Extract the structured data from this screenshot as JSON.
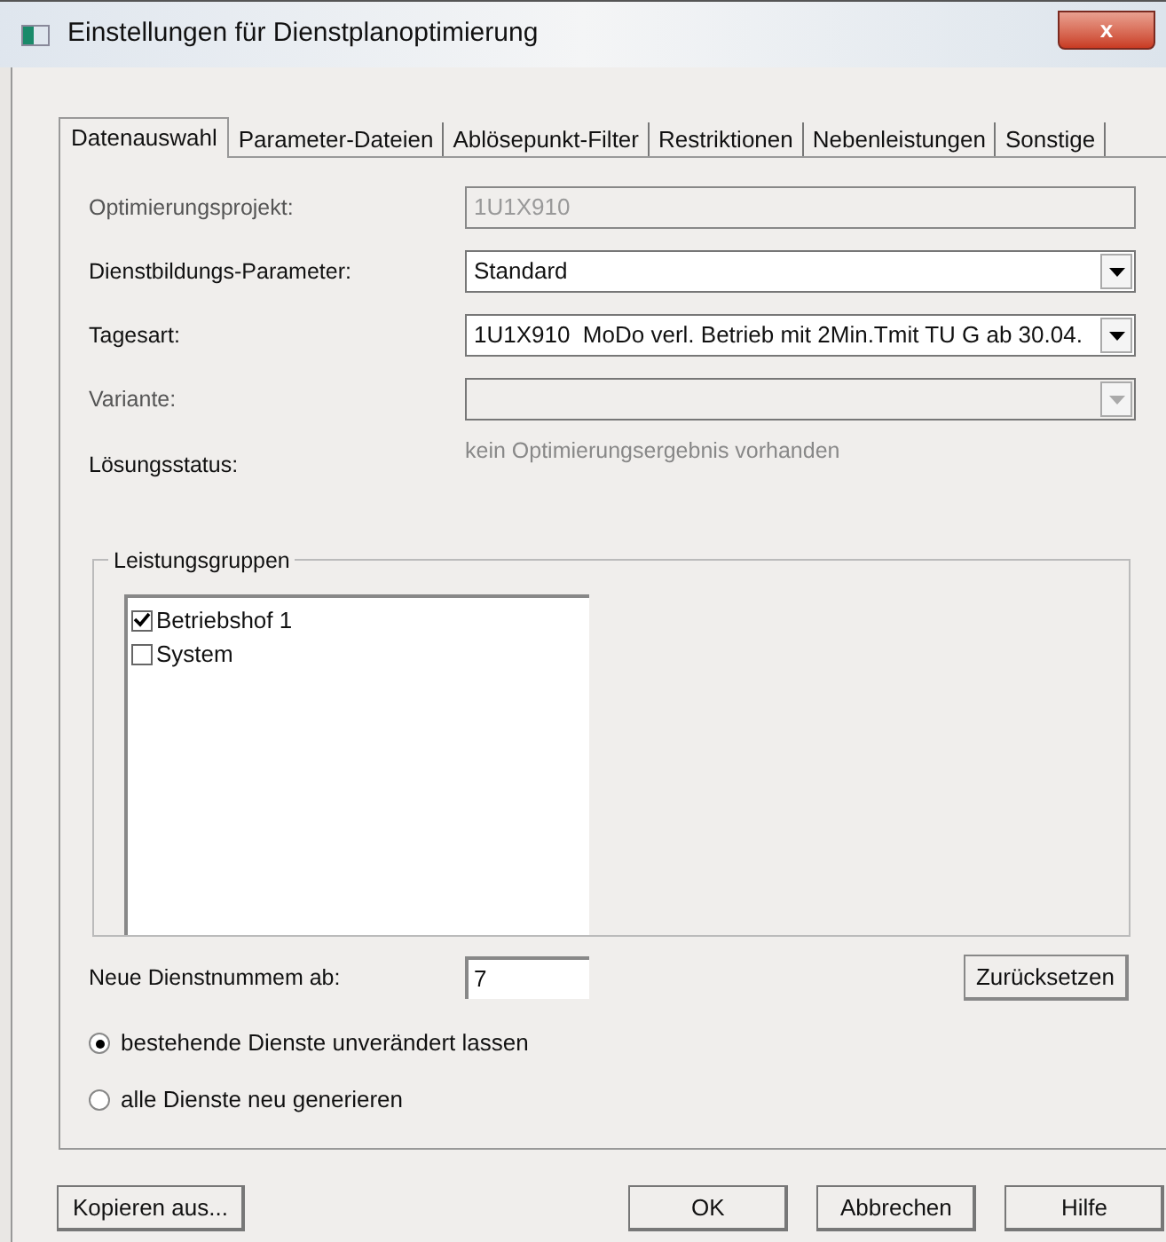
{
  "window": {
    "title": "Einstellungen für Dienstplanoptimierung",
    "close": "x"
  },
  "tabs": [
    {
      "label": "Datenauswahl",
      "selected": true
    },
    {
      "label": "Parameter-Dateien",
      "selected": false
    },
    {
      "label": "Ablösepunkt-Filter",
      "selected": false
    },
    {
      "label": "Restriktionen",
      "selected": false
    },
    {
      "label": "Nebenleistungen",
      "selected": false
    },
    {
      "label": "Sonstige",
      "selected": false
    }
  ],
  "fields": [
    {
      "label": "Optimierungsprojekt:",
      "kind": "text",
      "value": "1U1X910",
      "disabled": true
    },
    {
      "label": "Dienstbildungs-Parameter:",
      "kind": "dropdown",
      "value": "Standard",
      "disabled": false
    },
    {
      "label": "Tagesart:",
      "kind": "dropdown",
      "value": "1U1X910  MoDo verl. Betrieb mit 2Min.Tmit TU G ab 30.04.",
      "disabled": false
    },
    {
      "label": "Variante:",
      "kind": "dropdown",
      "disabled": true
    },
    {
      "label": "Lösungsstatus:",
      "kind": "status",
      "value": "kein Optimierungsergebnis vorhanden"
    }
  ],
  "leistungsgruppen": {
    "title": "Leistungsgruppen",
    "items": [
      {
        "label": "Betriebshof 1",
        "checked": true
      },
      {
        "label": "System",
        "checked": false
      }
    ]
  },
  "dienstnummern": {
    "label": "Neue Dienstnummem ab:",
    "value": "7",
    "reset_button": "Zurücksetzen"
  },
  "options": [
    {
      "label": "bestehende Dienste unverändert lassen",
      "selected": true
    },
    {
      "label": "alle Dienste neu generieren",
      "selected": false
    }
  ],
  "buttons": {
    "left": "Kopieren aus...",
    "right": [
      "OK",
      "Abbrechen",
      "Hilfe"
    ]
  }
}
